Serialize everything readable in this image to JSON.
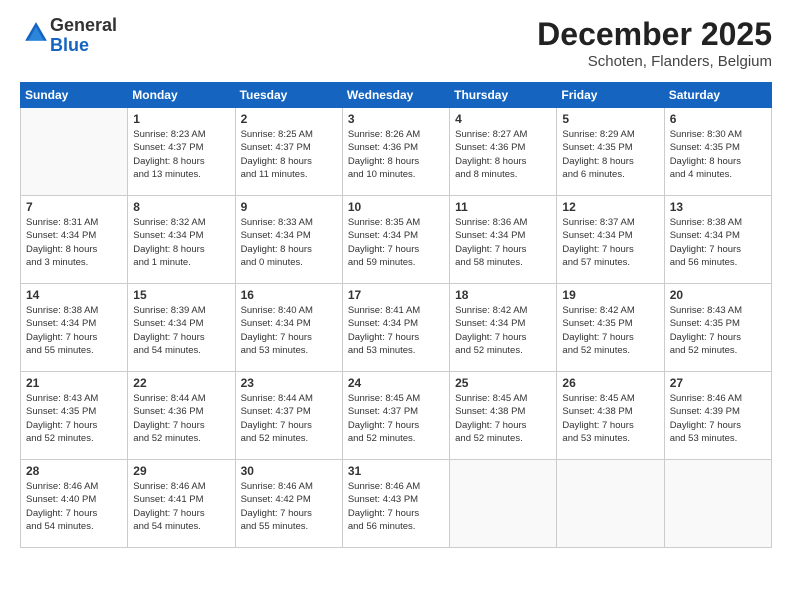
{
  "logo": {
    "general": "General",
    "blue": "Blue"
  },
  "title": "December 2025",
  "location": "Schoten, Flanders, Belgium",
  "days_header": [
    "Sunday",
    "Monday",
    "Tuesday",
    "Wednesday",
    "Thursday",
    "Friday",
    "Saturday"
  ],
  "weeks": [
    [
      {
        "day": "",
        "info": ""
      },
      {
        "day": "1",
        "info": "Sunrise: 8:23 AM\nSunset: 4:37 PM\nDaylight: 8 hours\nand 13 minutes."
      },
      {
        "day": "2",
        "info": "Sunrise: 8:25 AM\nSunset: 4:37 PM\nDaylight: 8 hours\nand 11 minutes."
      },
      {
        "day": "3",
        "info": "Sunrise: 8:26 AM\nSunset: 4:36 PM\nDaylight: 8 hours\nand 10 minutes."
      },
      {
        "day": "4",
        "info": "Sunrise: 8:27 AM\nSunset: 4:36 PM\nDaylight: 8 hours\nand 8 minutes."
      },
      {
        "day": "5",
        "info": "Sunrise: 8:29 AM\nSunset: 4:35 PM\nDaylight: 8 hours\nand 6 minutes."
      },
      {
        "day": "6",
        "info": "Sunrise: 8:30 AM\nSunset: 4:35 PM\nDaylight: 8 hours\nand 4 minutes."
      }
    ],
    [
      {
        "day": "7",
        "info": "Sunrise: 8:31 AM\nSunset: 4:34 PM\nDaylight: 8 hours\nand 3 minutes."
      },
      {
        "day": "8",
        "info": "Sunrise: 8:32 AM\nSunset: 4:34 PM\nDaylight: 8 hours\nand 1 minute."
      },
      {
        "day": "9",
        "info": "Sunrise: 8:33 AM\nSunset: 4:34 PM\nDaylight: 8 hours\nand 0 minutes."
      },
      {
        "day": "10",
        "info": "Sunrise: 8:35 AM\nSunset: 4:34 PM\nDaylight: 7 hours\nand 59 minutes."
      },
      {
        "day": "11",
        "info": "Sunrise: 8:36 AM\nSunset: 4:34 PM\nDaylight: 7 hours\nand 58 minutes."
      },
      {
        "day": "12",
        "info": "Sunrise: 8:37 AM\nSunset: 4:34 PM\nDaylight: 7 hours\nand 57 minutes."
      },
      {
        "day": "13",
        "info": "Sunrise: 8:38 AM\nSunset: 4:34 PM\nDaylight: 7 hours\nand 56 minutes."
      }
    ],
    [
      {
        "day": "14",
        "info": "Sunrise: 8:38 AM\nSunset: 4:34 PM\nDaylight: 7 hours\nand 55 minutes."
      },
      {
        "day": "15",
        "info": "Sunrise: 8:39 AM\nSunset: 4:34 PM\nDaylight: 7 hours\nand 54 minutes."
      },
      {
        "day": "16",
        "info": "Sunrise: 8:40 AM\nSunset: 4:34 PM\nDaylight: 7 hours\nand 53 minutes."
      },
      {
        "day": "17",
        "info": "Sunrise: 8:41 AM\nSunset: 4:34 PM\nDaylight: 7 hours\nand 53 minutes."
      },
      {
        "day": "18",
        "info": "Sunrise: 8:42 AM\nSunset: 4:34 PM\nDaylight: 7 hours\nand 52 minutes."
      },
      {
        "day": "19",
        "info": "Sunrise: 8:42 AM\nSunset: 4:35 PM\nDaylight: 7 hours\nand 52 minutes."
      },
      {
        "day": "20",
        "info": "Sunrise: 8:43 AM\nSunset: 4:35 PM\nDaylight: 7 hours\nand 52 minutes."
      }
    ],
    [
      {
        "day": "21",
        "info": "Sunrise: 8:43 AM\nSunset: 4:35 PM\nDaylight: 7 hours\nand 52 minutes."
      },
      {
        "day": "22",
        "info": "Sunrise: 8:44 AM\nSunset: 4:36 PM\nDaylight: 7 hours\nand 52 minutes."
      },
      {
        "day": "23",
        "info": "Sunrise: 8:44 AM\nSunset: 4:37 PM\nDaylight: 7 hours\nand 52 minutes."
      },
      {
        "day": "24",
        "info": "Sunrise: 8:45 AM\nSunset: 4:37 PM\nDaylight: 7 hours\nand 52 minutes."
      },
      {
        "day": "25",
        "info": "Sunrise: 8:45 AM\nSunset: 4:38 PM\nDaylight: 7 hours\nand 52 minutes."
      },
      {
        "day": "26",
        "info": "Sunrise: 8:45 AM\nSunset: 4:38 PM\nDaylight: 7 hours\nand 53 minutes."
      },
      {
        "day": "27",
        "info": "Sunrise: 8:46 AM\nSunset: 4:39 PM\nDaylight: 7 hours\nand 53 minutes."
      }
    ],
    [
      {
        "day": "28",
        "info": "Sunrise: 8:46 AM\nSunset: 4:40 PM\nDaylight: 7 hours\nand 54 minutes."
      },
      {
        "day": "29",
        "info": "Sunrise: 8:46 AM\nSunset: 4:41 PM\nDaylight: 7 hours\nand 54 minutes."
      },
      {
        "day": "30",
        "info": "Sunrise: 8:46 AM\nSunset: 4:42 PM\nDaylight: 7 hours\nand 55 minutes."
      },
      {
        "day": "31",
        "info": "Sunrise: 8:46 AM\nSunset: 4:43 PM\nDaylight: 7 hours\nand 56 minutes."
      },
      {
        "day": "",
        "info": ""
      },
      {
        "day": "",
        "info": ""
      },
      {
        "day": "",
        "info": ""
      }
    ]
  ]
}
